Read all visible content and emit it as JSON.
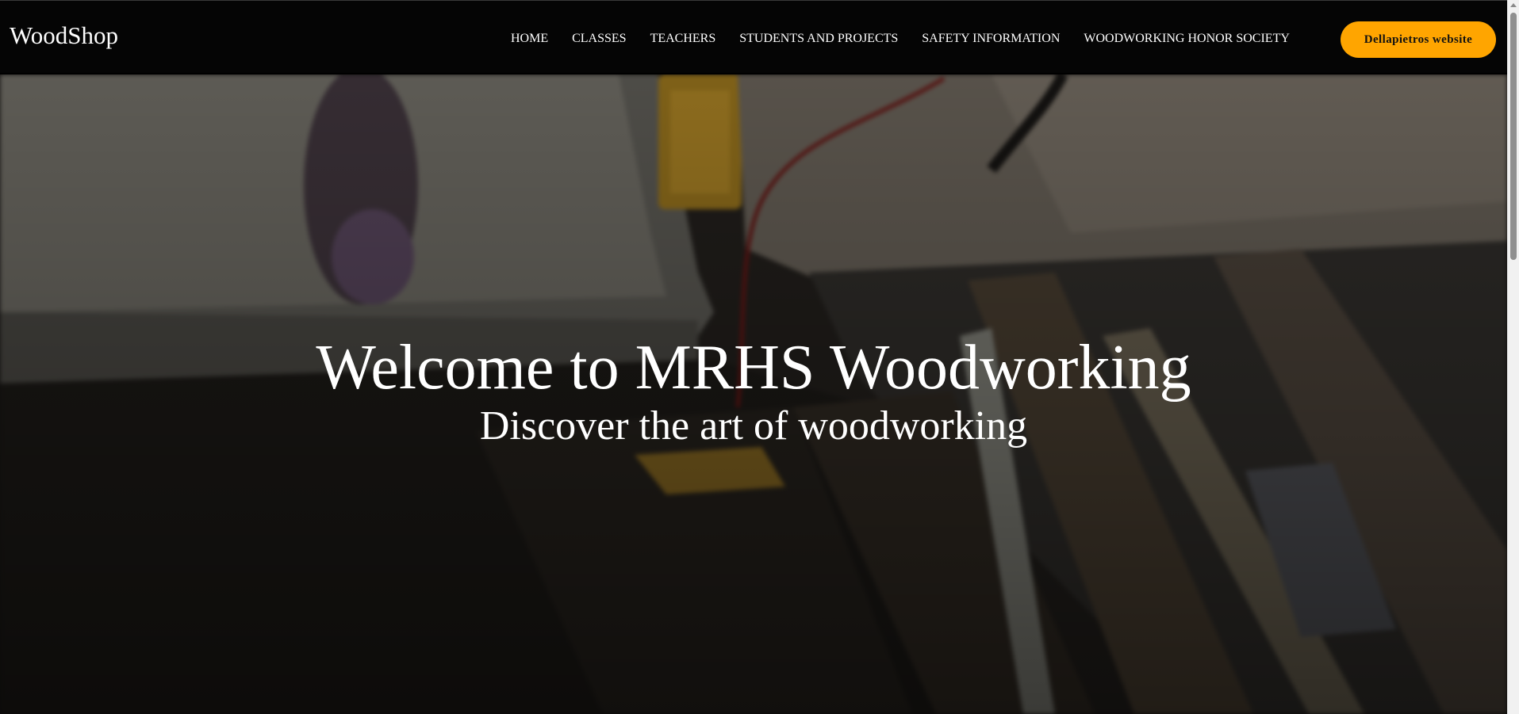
{
  "navbar": {
    "logo": "WoodShop",
    "links": [
      {
        "label": "HOME"
      },
      {
        "label": "CLASSES"
      },
      {
        "label": "TEACHERS"
      },
      {
        "label": "STUDENTS AND PROJECTS"
      },
      {
        "label": "SAFETY INFORMATION"
      },
      {
        "label": "WOODWORKING HONOR SOCIETY"
      }
    ],
    "cta_label": "Dellapietros website"
  },
  "hero": {
    "title": "Welcome to MRHS Woodworking",
    "subtitle": "Discover the art of woodworking"
  },
  "colors": {
    "accent": "#ffa500",
    "navbar_bg": "#050505",
    "text": "#ffffff"
  }
}
